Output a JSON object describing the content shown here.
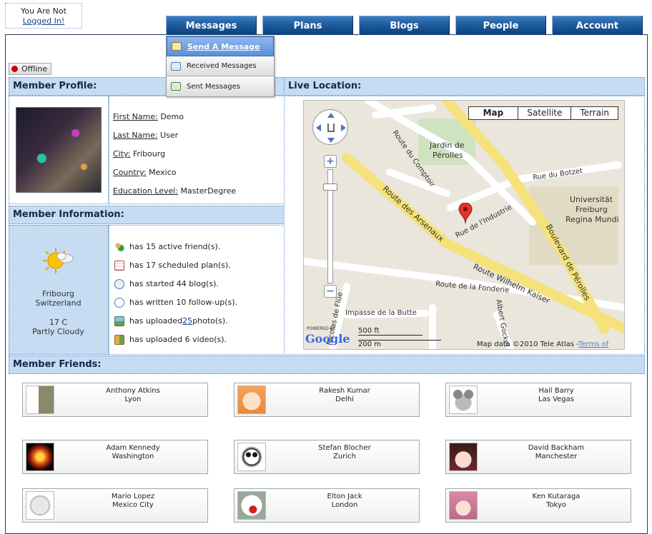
{
  "login": {
    "line1": "You Are Not",
    "link": "Logged In!"
  },
  "nav": {
    "tabs": [
      "Messages",
      "Plans",
      "Blogs",
      "People",
      "Account"
    ]
  },
  "messages_menu": {
    "items": [
      "Send A Message",
      "Received Messages",
      "Sent Messages"
    ]
  },
  "status": {
    "label": "Offline",
    "color": "#d00000"
  },
  "profile": {
    "header": "Member Profile:",
    "fields": [
      {
        "label": "First Name:",
        "value": "Demo"
      },
      {
        "label": "Last Name:",
        "value": "User"
      },
      {
        "label": "City:",
        "value": "Fribourg"
      },
      {
        "label": "Country:",
        "value": "Mexico"
      },
      {
        "label": "Education Level:",
        "value": "MasterDegree"
      }
    ]
  },
  "info": {
    "header": "Member Information:",
    "weather": {
      "city": "Fribourg",
      "country": "Switzerland",
      "temp": "17 C",
      "condition": "Partly Cloudy"
    },
    "stats": {
      "friends": "has 15 active friend(s).",
      "plans": "has 17 scheduled plan(s).",
      "blogs": "has started 44 blog(s).",
      "followups": "has written 10 follow-up(s).",
      "photos_pre": "has uploaded ",
      "photos_link": "25",
      "photos_post": " photo(s).",
      "videos": "has uploaded 6 video(s)."
    }
  },
  "location": {
    "header": "Live Location:",
    "map_types": [
      "Map",
      "Satellite",
      "Terrain"
    ],
    "labels": {
      "jardin": "Jardin de",
      "jardin2": "Pérolles",
      "route_comptoir": "Route du Comptoir",
      "rue_botzet": "Rue du Botzet",
      "univ1": "Universität",
      "univ2": "Freiburg",
      "univ3": "Regina Mundi",
      "arsenaux": "Route des Arsenaux",
      "industrie": "Rue de l'Industrie",
      "perolles": "Boulevard de Pérolles",
      "wilhelm": "Route Wilhelm Kaiser",
      "fonderie": "Route de la Fonderie",
      "impasse": "Impasse de la Butte",
      "flue": "Nicolas de Flüe",
      "gockel": "Albert Gockel",
      "scale_ft": "500 ft",
      "scale_m": "200 m",
      "powered": "POWERED BY",
      "google": "Google",
      "copyright": "Map data ©2010 Tele Atlas -",
      "terms": "Terms of Use"
    }
  },
  "friends": {
    "header": "Member Friends:",
    "list": [
      {
        "name": "Anthony Atkins",
        "city": "Lyon"
      },
      {
        "name": "Rakesh Kumar",
        "city": "Delhi"
      },
      {
        "name": "Hail Barry",
        "city": "Las Vegas"
      },
      {
        "name": "Adam Kennedy",
        "city": "Washington"
      },
      {
        "name": "Stefan Blocher",
        "city": "Zurich"
      },
      {
        "name": "David Backham",
        "city": "Manchester"
      },
      {
        "name": "Mario Lopez",
        "city": "Mexico City"
      },
      {
        "name": "Elton Jack",
        "city": "London"
      },
      {
        "name": "Ken Kutaraga",
        "city": "Tokyo"
      }
    ]
  }
}
